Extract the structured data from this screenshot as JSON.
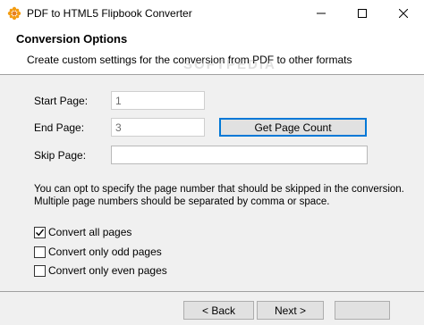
{
  "window": {
    "title": "PDF to HTML5 Flipbook Converter"
  },
  "header": {
    "title": "Conversion Options",
    "subtitle": "Create custom settings for the conversion from PDF to other formats",
    "watermark": "SOFTPEDIA"
  },
  "form": {
    "start_page_label": "Start Page:",
    "start_page_value": "1",
    "end_page_label": "End Page:",
    "end_page_value": "3",
    "get_page_count_label": "Get Page Count",
    "skip_page_label": "Skip Page:",
    "skip_page_value": ""
  },
  "info_text": "You can opt to specify the page number that should be skipped in the conversion. Multiple page numbers should be separated by comma or space.",
  "options": [
    {
      "label": "Convert all pages",
      "checked": true
    },
    {
      "label": "Convert only odd pages",
      "checked": false
    },
    {
      "label": "Convert only even pages",
      "checked": false
    }
  ],
  "footer": {
    "back_label": "< Back",
    "next_label": "Next >"
  },
  "icons": [
    "app-icon",
    "minimize-icon",
    "maximize-icon",
    "close-icon",
    "checkmark-icon"
  ]
}
